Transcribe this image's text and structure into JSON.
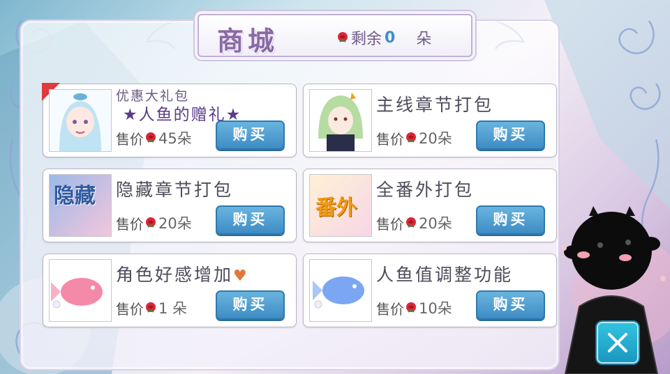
{
  "header": {
    "title": "商城",
    "remaining_label": "剩余",
    "remaining_count": "0",
    "remaining_unit": "朵"
  },
  "items": [
    {
      "title_line1": "优惠大礼包",
      "title_line2": "★人鱼的赠礼★",
      "price_label": "售价",
      "price_amount": "45朵",
      "buy_label": "购买",
      "thumb_icon": "mermaid-portrait-icon",
      "badge": "sale-ribbon"
    },
    {
      "title": "主线章节打包",
      "price_label": "售价",
      "price_amount": "20朵",
      "buy_label": "购买",
      "thumb_icon": "green-hair-character-icon"
    },
    {
      "title": "隐藏章节打包",
      "price_label": "售价",
      "price_amount": "20朵",
      "buy_label": "购买",
      "thumb_icon": "hidden-chapter-icon",
      "thumb_text": "隐藏"
    },
    {
      "title": "全番外打包",
      "price_label": "售价",
      "price_amount": "20朵",
      "buy_label": "购买",
      "thumb_icon": "extra-chapter-icon",
      "thumb_text": "番外"
    },
    {
      "title": "角色好感增加",
      "price_label": "售价",
      "price_amount": "1 朵",
      "buy_label": "购买",
      "thumb_icon": "pink-fish-icon",
      "title_suffix_icon": "heart-icon"
    },
    {
      "title": "人鱼值调整功能",
      "price_label": "售价",
      "price_amount": "10朵",
      "buy_label": "购买",
      "thumb_icon": "blue-fish-icon"
    }
  ],
  "colors": {
    "buy_button": "#3d8cc4",
    "close_button": "#1a98c0",
    "rose": "#d9283a",
    "title": "#8a6aa6"
  }
}
